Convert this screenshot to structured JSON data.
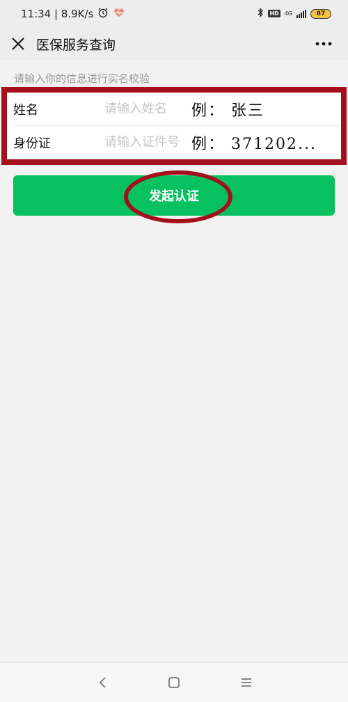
{
  "status_bar": {
    "time_speed": "11:34 | 8.9K/s",
    "network": "4G",
    "hd": "HD",
    "battery": "87",
    "icons": [
      "alarm-icon",
      "health-icon",
      "bluetooth-icon",
      "signal-icon",
      "battery-icon"
    ]
  },
  "nav": {
    "title": "医保服务查询",
    "close_icon": "close-icon",
    "more_icon": "more-icon"
  },
  "form": {
    "hint": "请输入你的信息进行实名校验",
    "name_label": "姓名",
    "name_placeholder": "请输入姓名",
    "name_example": "例： 张三",
    "id_label": "身份证",
    "id_placeholder": "请输入证件号",
    "id_example": "例： 371202..."
  },
  "submit": {
    "label": "发起认证",
    "color": "#07c160"
  },
  "annotation": {
    "color": "#a30f1a"
  },
  "bottom_nav": {
    "icons": [
      "back-icon",
      "home-icon",
      "menu-icon"
    ]
  }
}
